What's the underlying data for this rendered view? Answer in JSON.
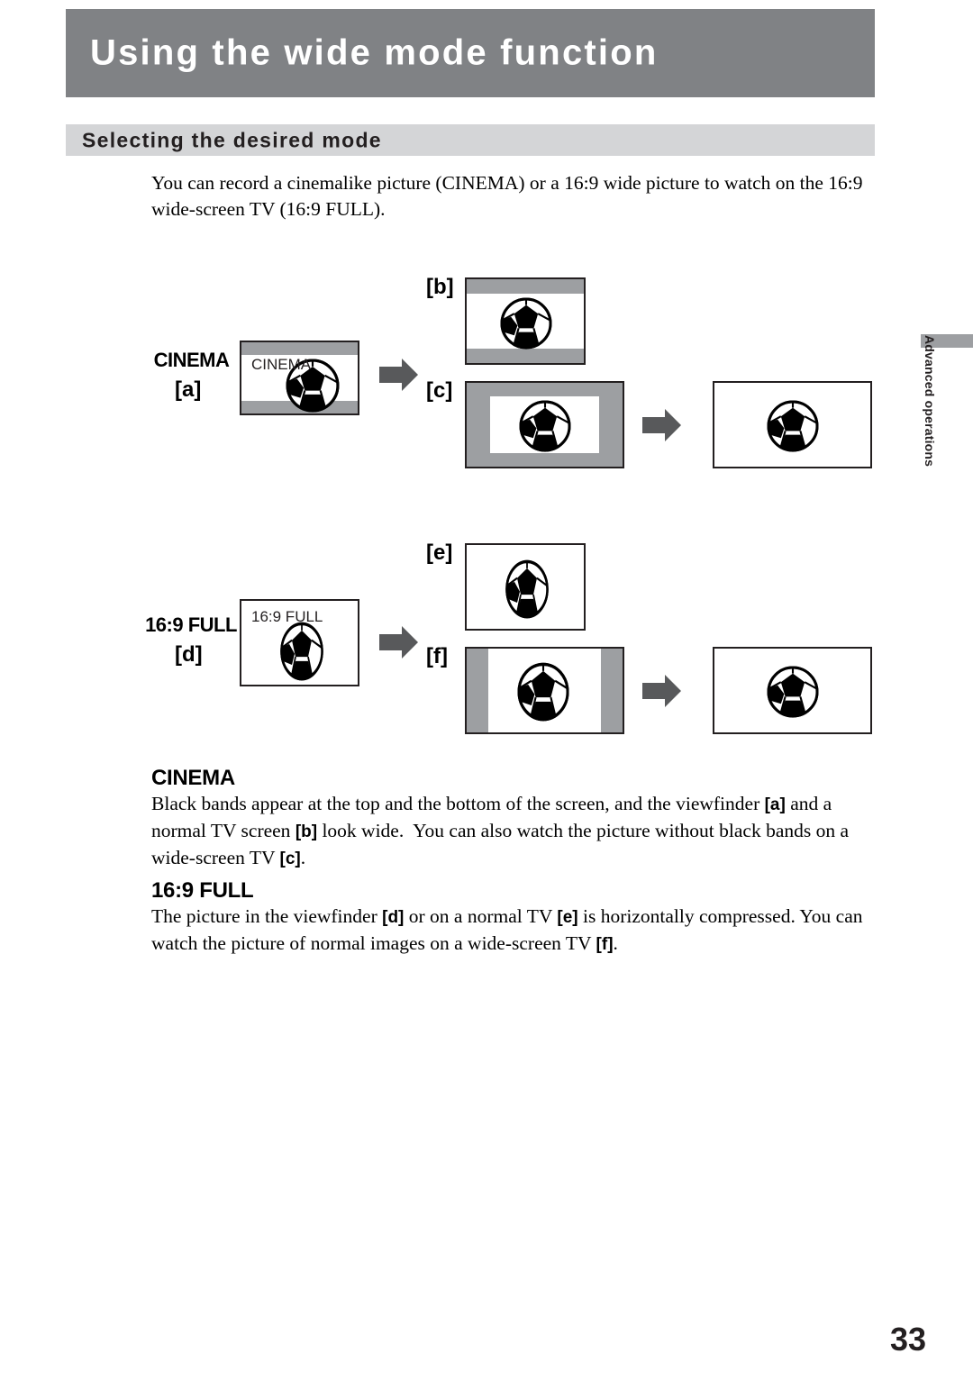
{
  "page": {
    "number": "33",
    "side_tab": "Advanced operations",
    "accent_gray": "#808285",
    "light_gray": "#d4d5d7",
    "band_gray": "#9d9fa2",
    "ink": "#231f20"
  },
  "header": {
    "title": "Using the wide mode function",
    "subtitle": "Selecting the desired mode"
  },
  "intro": {
    "text": "You can record a cinemalike picture (CINEMA) or a 16:9 wide picture to watch on the 16:9 wide-screen TV (16:9 FULL)."
  },
  "diagram": {
    "cinema": {
      "mode_label": "CINEMA",
      "source_tag": "[a]",
      "viewfinder_osd": "CINEMA",
      "targets": [
        {
          "tag": "[b]",
          "desc": "normal-tv-with-black-bands"
        },
        {
          "tag": "[c]",
          "desc": "wide-screen-tv-letterbox"
        }
      ],
      "final_desc": "wide-screen-tv-full"
    },
    "full169": {
      "mode_label": "16:9 FULL",
      "source_tag": "[d]",
      "viewfinder_osd": "16:9 FULL",
      "targets": [
        {
          "tag": "[e]",
          "desc": "normal-tv-compressed"
        },
        {
          "tag": "[f]",
          "desc": "wide-screen-tv-side-bands"
        }
      ],
      "final_desc": "wide-screen-tv-full"
    }
  },
  "sections": [
    {
      "heading": "CINEMA",
      "body_html": "Black bands appear at the top and the bottom of the screen, and the viewfinder <b>[a]</b> and a normal TV screen <b>[b]</b> look wide.&nbsp; You can also watch the picture without black bands on a wide-screen TV <b>[c]</b>."
    },
    {
      "heading": "16:9 FULL",
      "body_html": "The picture in the viewfinder <b>[d]</b> or on a normal TV <b>[e]</b> is horizontally compressed. You can watch the picture of normal images on a wide-screen TV <b>[f]</b>."
    }
  ]
}
